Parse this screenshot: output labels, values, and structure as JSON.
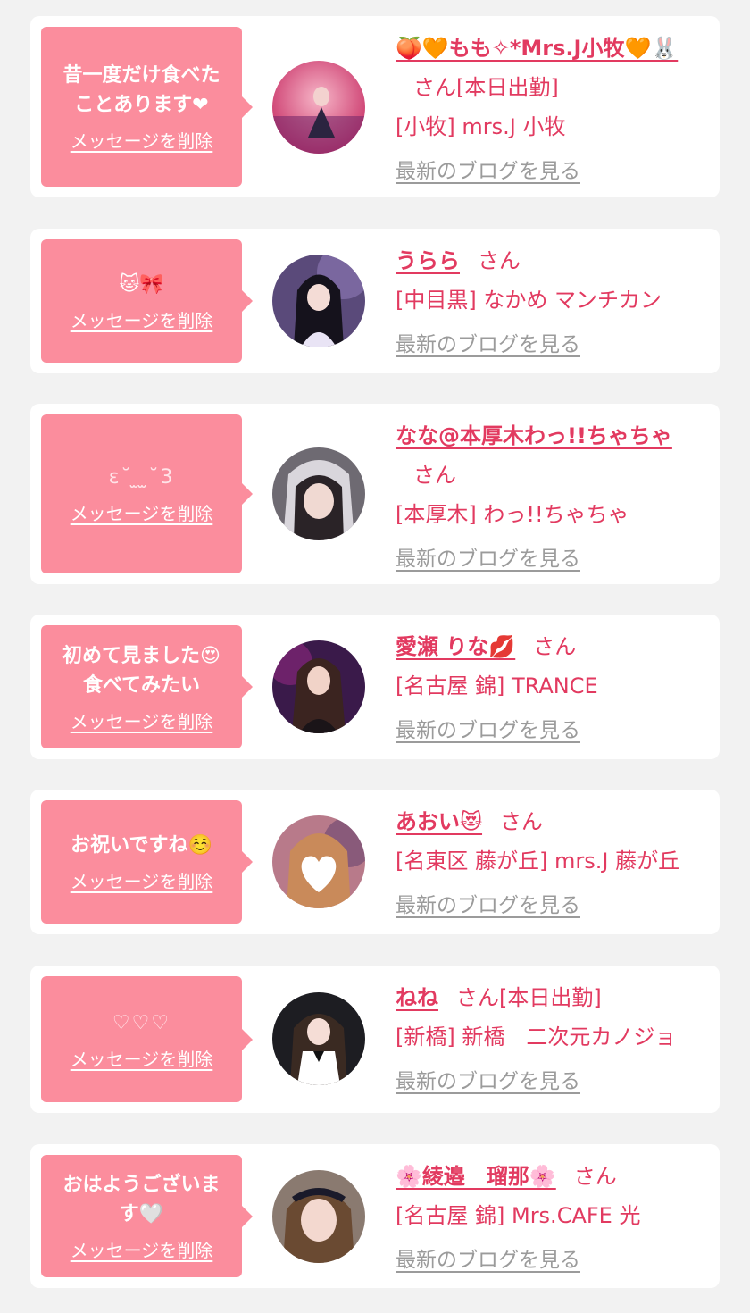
{
  "delete_label": "メッセージを削除",
  "blog_label": "最新のブログを見る",
  "colors": {
    "bubble": "#fb8d9d",
    "accent": "#e23a60",
    "muted": "#9b9b9b",
    "background": "#f2f2f2"
  },
  "messages": [
    {
      "message": "昔一度だけ食べた\nことあります❤",
      "name": "🍑🧡もも✧*Mrs.J小牧🧡🐰",
      "honorific": "さん",
      "status": "[本日出勤]",
      "shop": "[小牧] mrs.J 小牧",
      "avatar_icon": "avatar-photo-icon"
    },
    {
      "message": "🐱🎀",
      "name": "うらら",
      "honorific": "さん",
      "status": "",
      "shop": "[中目黒] なかめ マンチカン",
      "avatar_icon": "avatar-photo-icon"
    },
    {
      "message": "ɛ˘ ̫ ̫˘3",
      "name": "なな@本厚木わっ!!ちゃちゃ",
      "honorific": "さん",
      "status": "",
      "shop": "[本厚木] わっ!!ちゃちゃ",
      "avatar_icon": "avatar-photo-icon"
    },
    {
      "message": "初めて見ました😍\n食べてみたい",
      "name": "愛瀬 りな💋",
      "honorific": "さん",
      "status": "",
      "shop": "[名古屋 錦] TRANCE",
      "avatar_icon": "avatar-photo-icon"
    },
    {
      "message": "お祝いですね☺️",
      "name": "あおい😻",
      "honorific": "さん",
      "status": "",
      "shop": "[名東区 藤が丘] mrs.J 藤が丘",
      "avatar_icon": "avatar-photo-icon"
    },
    {
      "message": "♡♡♡",
      "name": "ねね",
      "honorific": "さん",
      "status": "[本日出勤]",
      "shop": "[新橋] 新橋　二次元カノジョ",
      "avatar_icon": "avatar-photo-icon"
    },
    {
      "message": "おはようございま\nす🤍",
      "name": "🌸綾邉　瑠那🌸",
      "honorific": "さん",
      "status": "",
      "shop": "[名古屋 錦] Mrs.CAFE 光",
      "avatar_icon": "avatar-photo-icon"
    }
  ]
}
